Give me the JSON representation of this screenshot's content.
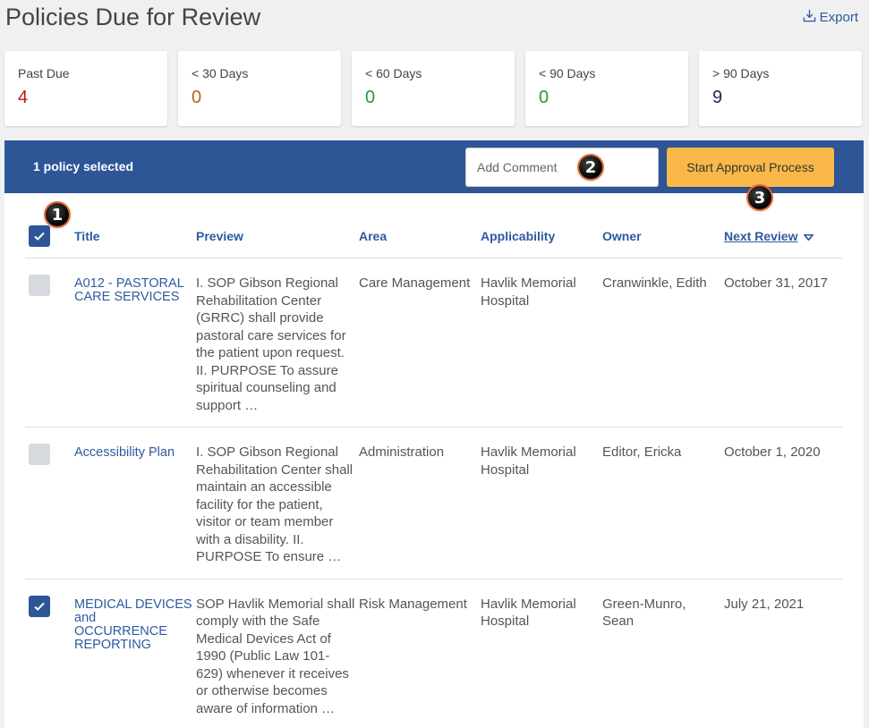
{
  "header": {
    "title": "Policies Due for Review",
    "export_label": "Export"
  },
  "stats": [
    {
      "label": "Past Due",
      "value": "4",
      "color": "#c0151a"
    },
    {
      "label": "< 30 Days",
      "value": "0",
      "color": "#b7630c"
    },
    {
      "label": "< 60 Days",
      "value": "0",
      "color": "#1d9b3c"
    },
    {
      "label": "< 90 Days",
      "value": "0",
      "color": "#1d9b3c"
    },
    {
      "label": "> 90 Days",
      "value": "9",
      "color": "#1a2a4a"
    }
  ],
  "toolbar": {
    "selection_text": "1 policy selected",
    "comment_placeholder": "Add Comment",
    "approve_label": "Start Approval Process"
  },
  "markers": [
    "1",
    "2",
    "3"
  ],
  "table": {
    "columns": {
      "title": "Title",
      "preview": "Preview",
      "area": "Area",
      "applicability": "Applicability",
      "owner": "Owner",
      "next_review": "Next Review"
    },
    "rows": [
      {
        "checked": false,
        "title": "A012 - PASTORAL CARE SERVICES",
        "preview": "I. SOP Gibson Regional Rehabilitation Center (GRRC) shall provide pastoral care services for the patient upon request. II. PURPOSE To assure spiritual counseling and support …",
        "area": "Care Management",
        "applicability": "Havlik Memorial Hospital",
        "owner": "Cranwinkle, Edith",
        "next_review": "October 31, 2017"
      },
      {
        "checked": false,
        "title": "Accessibility Plan",
        "preview": "I. SOP Gibson Regional Rehabilitation Center shall maintain an accessible facility for the patient, visitor or team member with a disability. II. PURPOSE To ensure …",
        "area": "Administration",
        "applicability": "Havlik Memorial Hospital",
        "owner": "Editor, Ericka",
        "next_review": "October 1, 2020"
      },
      {
        "checked": true,
        "title": "MEDICAL DEVICES and OCCURRENCE REPORTING",
        "preview": "SOP Havlik Memorial shall comply with the Safe Medical Devices Act of 1990 (Public Law 101-629) whenever it receives or otherwise becomes aware of information …",
        "area": "Risk Management",
        "applicability": "Havlik Memorial Hospital",
        "owner": "Green-Munro, Sean",
        "next_review": "July 21, 2021"
      }
    ]
  }
}
